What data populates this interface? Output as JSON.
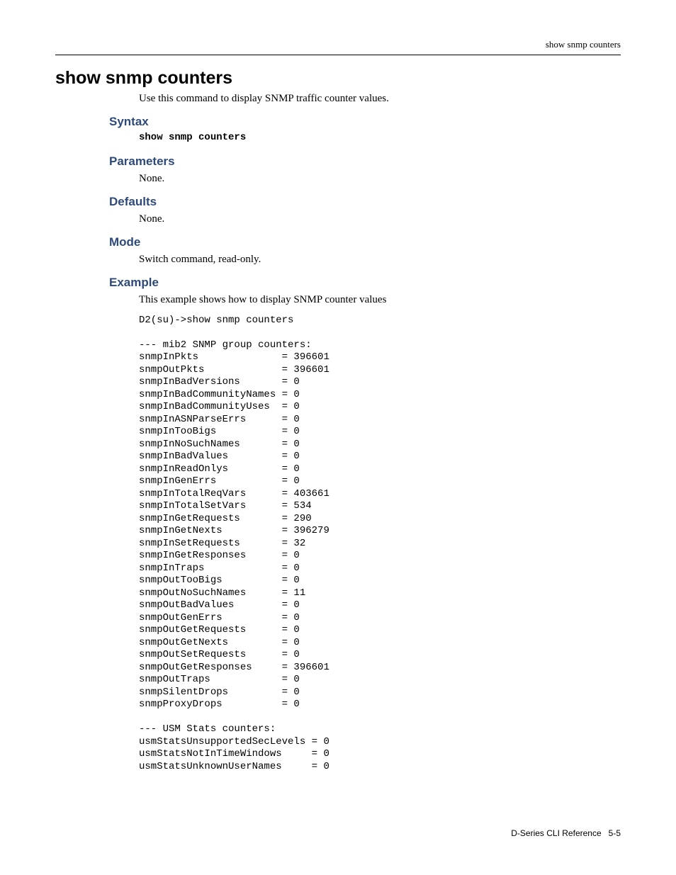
{
  "header": {
    "running": "show snmp counters"
  },
  "title": "show snmp counters",
  "description": "Use this command to display SNMP traffic counter values.",
  "sections": {
    "syntax": {
      "heading": "Syntax",
      "command": "show snmp counters"
    },
    "parameters": {
      "heading": "Parameters",
      "text": "None."
    },
    "defaults": {
      "heading": "Defaults",
      "text": "None."
    },
    "mode": {
      "heading": "Mode",
      "text": "Switch command, read-only."
    },
    "example": {
      "heading": "Example",
      "text": "This example shows how to display SNMP counter values",
      "output": "D2(su)->show snmp counters\n\n--- mib2 SNMP group counters:\nsnmpInPkts              = 396601\nsnmpOutPkts             = 396601\nsnmpInBadVersions       = 0\nsnmpInBadCommunityNames = 0\nsnmpInBadCommunityUses  = 0\nsnmpInASNParseErrs      = 0\nsnmpInTooBigs           = 0\nsnmpInNoSuchNames       = 0\nsnmpInBadValues         = 0\nsnmpInReadOnlys         = 0\nsnmpInGenErrs           = 0\nsnmpInTotalReqVars      = 403661\nsnmpInTotalSetVars      = 534\nsnmpInGetRequests       = 290\nsnmpInGetNexts          = 396279\nsnmpInSetRequests       = 32\nsnmpInGetResponses      = 0\nsnmpInTraps             = 0\nsnmpOutTooBigs          = 0\nsnmpOutNoSuchNames      = 11\nsnmpOutBadValues        = 0\nsnmpOutGenErrs          = 0\nsnmpOutGetRequests      = 0\nsnmpOutGetNexts         = 0\nsnmpOutSetRequests      = 0\nsnmpOutGetResponses     = 396601\nsnmpOutTraps            = 0\nsnmpSilentDrops         = 0\nsnmpProxyDrops          = 0\n\n--- USM Stats counters:\nusmStatsUnsupportedSecLevels = 0\nusmStatsNotInTimeWindows     = 0\nusmStatsUnknownUserNames     = 0"
    }
  },
  "footer": {
    "doc": "D-Series CLI Reference",
    "page": "5-5"
  }
}
